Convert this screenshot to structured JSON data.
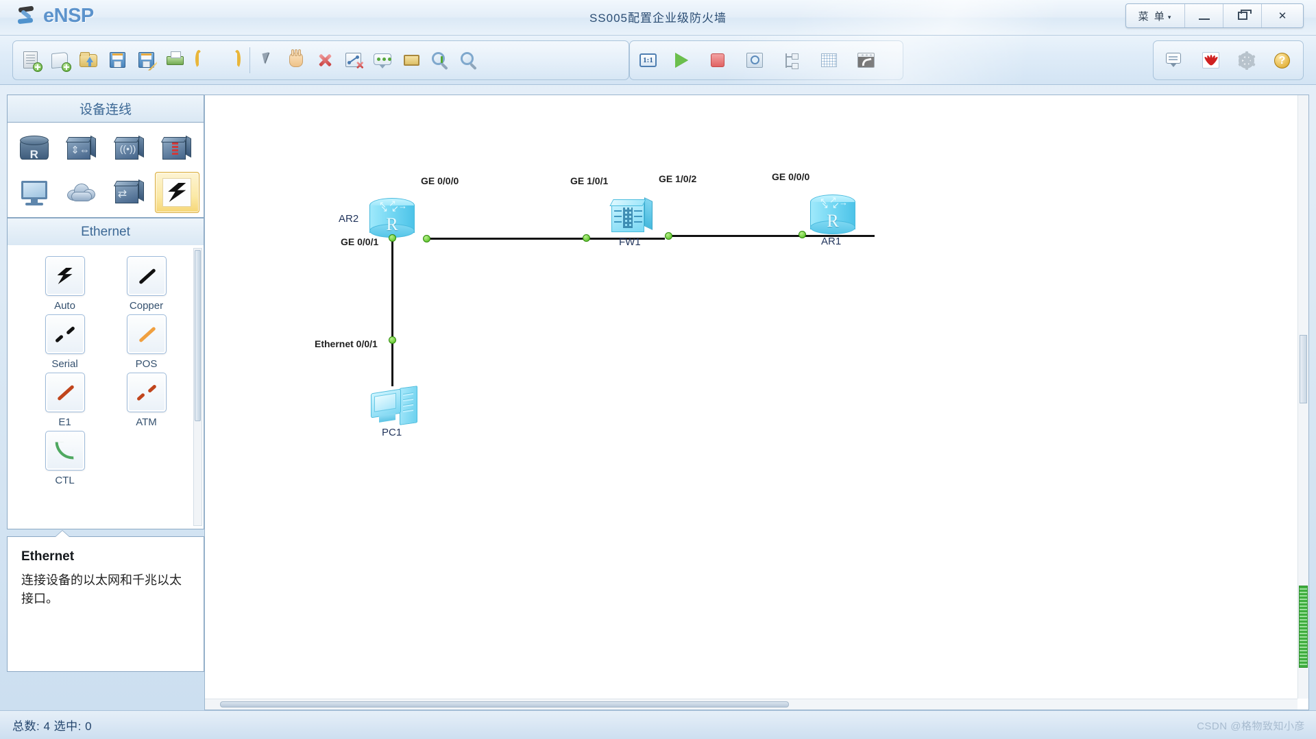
{
  "titlebar": {
    "logo_text": "eNSP",
    "window_title": "SS005配置企业级防火墙",
    "menu_label": "菜 单",
    "menu_caret": "▾",
    "minimize": "minimize",
    "maximize": "restore",
    "close": "✕"
  },
  "toolbar": {
    "groups": [
      {
        "buttons": [
          {
            "name": "new-topology-icon",
            "tip": "新建拓扑"
          },
          {
            "name": "new-scroll-icon",
            "tip": "新建试卷"
          },
          {
            "name": "open-folder-icon",
            "tip": "打开"
          },
          {
            "name": "save-icon",
            "tip": "保存"
          },
          {
            "name": "save-as-icon",
            "tip": "另存为"
          },
          {
            "name": "print-icon",
            "tip": "打印"
          },
          {
            "name": "undo-icon",
            "tip": "撤销"
          },
          {
            "name": "redo-icon",
            "tip": "恢复"
          },
          {
            "name": "pointer-icon",
            "tip": "选择"
          },
          {
            "name": "hand-icon",
            "tip": "移动"
          },
          {
            "name": "delete-icon",
            "tip": "删除"
          },
          {
            "name": "delete-connection-icon",
            "tip": "删除连线"
          },
          {
            "name": "add-note-icon",
            "tip": "添加描述"
          },
          {
            "name": "add-shape-icon",
            "tip": "添加图形"
          },
          {
            "name": "zoom-in-icon",
            "tip": "放大"
          },
          {
            "name": "zoom-out-icon",
            "tip": "缩小"
          }
        ]
      },
      {
        "buttons": [
          {
            "name": "zoom-reset-icon",
            "label": "1:1",
            "tip": "复原"
          },
          {
            "name": "start-device-icon",
            "tip": "开启设备"
          },
          {
            "name": "stop-device-icon",
            "tip": "关闭设备"
          },
          {
            "name": "packet-capture-icon",
            "tip": "数据抓包"
          },
          {
            "name": "topology-tree-icon",
            "tip": "显示拓扑树"
          },
          {
            "name": "grid-icon",
            "tip": "显示网格"
          },
          {
            "name": "console-window-icon",
            "tip": "命令行"
          }
        ]
      }
    ],
    "right_buttons": [
      {
        "name": "chat-icon",
        "tip": "交流"
      },
      {
        "name": "huawei-logo-icon",
        "tip": "华为"
      },
      {
        "name": "settings-gear-icon",
        "tip": "设置"
      },
      {
        "name": "help-icon",
        "label": "?",
        "tip": "帮助"
      }
    ]
  },
  "sidebar": {
    "header": "设备连线",
    "devices": [
      {
        "name": "device-router",
        "label": "路由器"
      },
      {
        "name": "device-switch",
        "label": "交换机"
      },
      {
        "name": "device-wlan",
        "label": "无线局域网"
      },
      {
        "name": "device-firewall",
        "label": "防火墙"
      },
      {
        "name": "device-endpoint",
        "label": "终端"
      },
      {
        "name": "device-cloud",
        "label": "其他设备"
      },
      {
        "name": "device-custom",
        "label": "自定义设备"
      },
      {
        "name": "device-connection",
        "label": "设备连线",
        "selected": true
      }
    ],
    "section_header": "Ethernet",
    "cables": [
      {
        "name": "cable-auto",
        "label": "Auto",
        "style": "bolt",
        "color": "#111111"
      },
      {
        "name": "cable-copper",
        "label": "Copper",
        "style": "solid",
        "color": "#111111"
      },
      {
        "name": "cable-serial",
        "label": "Serial",
        "style": "dashed",
        "color": "#111111"
      },
      {
        "name": "cable-pos",
        "label": "POS",
        "style": "solid",
        "color": "#f0a040"
      },
      {
        "name": "cable-e1",
        "label": "E1",
        "style": "solid",
        "color": "#c0451c"
      },
      {
        "name": "cable-atm",
        "label": "ATM",
        "style": "dashed",
        "color": "#c0451c"
      },
      {
        "name": "cable-ctl",
        "label": "CTL",
        "style": "curve",
        "color": "#4fa860"
      }
    ],
    "info": {
      "title": "Ethernet",
      "description": "连接设备的以太网和千兆以太接口。"
    }
  },
  "topology": {
    "nodes": [
      {
        "name": "node-ar2",
        "label": "AR2",
        "type": "router"
      },
      {
        "name": "node-fw1",
        "label": "FW1",
        "type": "firewall"
      },
      {
        "name": "node-ar1",
        "label": "AR1",
        "type": "router"
      },
      {
        "name": "node-pc1",
        "label": "PC1",
        "type": "pc"
      }
    ],
    "interfaces": [
      {
        "name": "iface-ar2-ge000",
        "label": "GE 0/0/0"
      },
      {
        "name": "iface-fw1-ge1011",
        "label": "GE 1/0/1"
      },
      {
        "name": "iface-fw1-ge1012",
        "label": "GE 1/0/2"
      },
      {
        "name": "iface-ar1-ge000",
        "label": "GE 0/0/0"
      },
      {
        "name": "iface-ar2-ge001",
        "label": "GE 0/0/1"
      },
      {
        "name": "iface-pc1-eth001",
        "label": "Ethernet 0/0/1"
      }
    ]
  },
  "statusbar": {
    "text": "总数: 4  选中: 0",
    "watermark": "CSDN @格物致知小彦"
  }
}
